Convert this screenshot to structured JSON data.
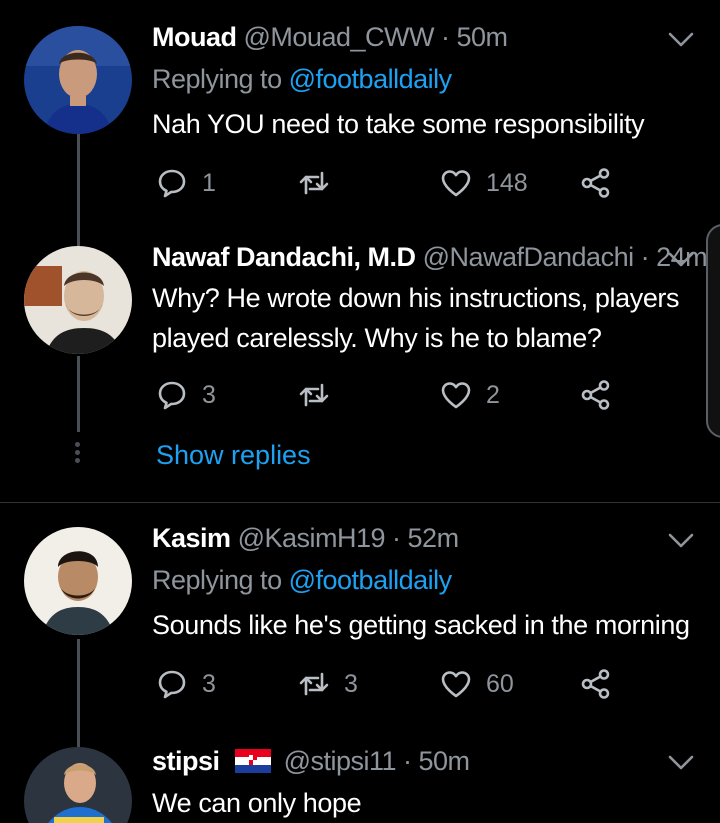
{
  "tweets": [
    {
      "name": "Mouad",
      "handle": "@Mouad_CWW",
      "time": "· 50m",
      "replying_prefix": "Replying to",
      "replying_handle": "@footballdaily",
      "text": "Nah YOU need to take some responsibility",
      "replies": "1",
      "retweets": "",
      "likes": "148"
    },
    {
      "name": "Nawaf Dandachi, M.D",
      "handle": "@NawafDandachi",
      "time": "· 24m",
      "text_lines": [
        "Why? He wrote down his instructions, players",
        "played carelessly. Why is he to blame?"
      ],
      "replies": "3",
      "retweets": "",
      "likes": "2",
      "show_replies": "Show replies"
    },
    {
      "name": "Kasim",
      "handle": "@KasimH19",
      "time": "· 52m",
      "replying_prefix": "Replying to",
      "replying_handle": "@footballdaily",
      "text": "Sounds like he's getting sacked in the morning",
      "replies": "3",
      "retweets": "3",
      "likes": "60"
    },
    {
      "name": "stipsi",
      "flag": "croatia-flag",
      "handle": "@stipsi11",
      "time": "· 50m",
      "text": "We can only hope"
    }
  ],
  "colors": {
    "background": "#000000",
    "accent": "#1da1f2",
    "muted": "#8e959c",
    "divider": "#2f3336"
  },
  "icons": [
    "chevron-down-icon",
    "reply-icon",
    "retweet-icon",
    "like-icon",
    "share-icon"
  ]
}
